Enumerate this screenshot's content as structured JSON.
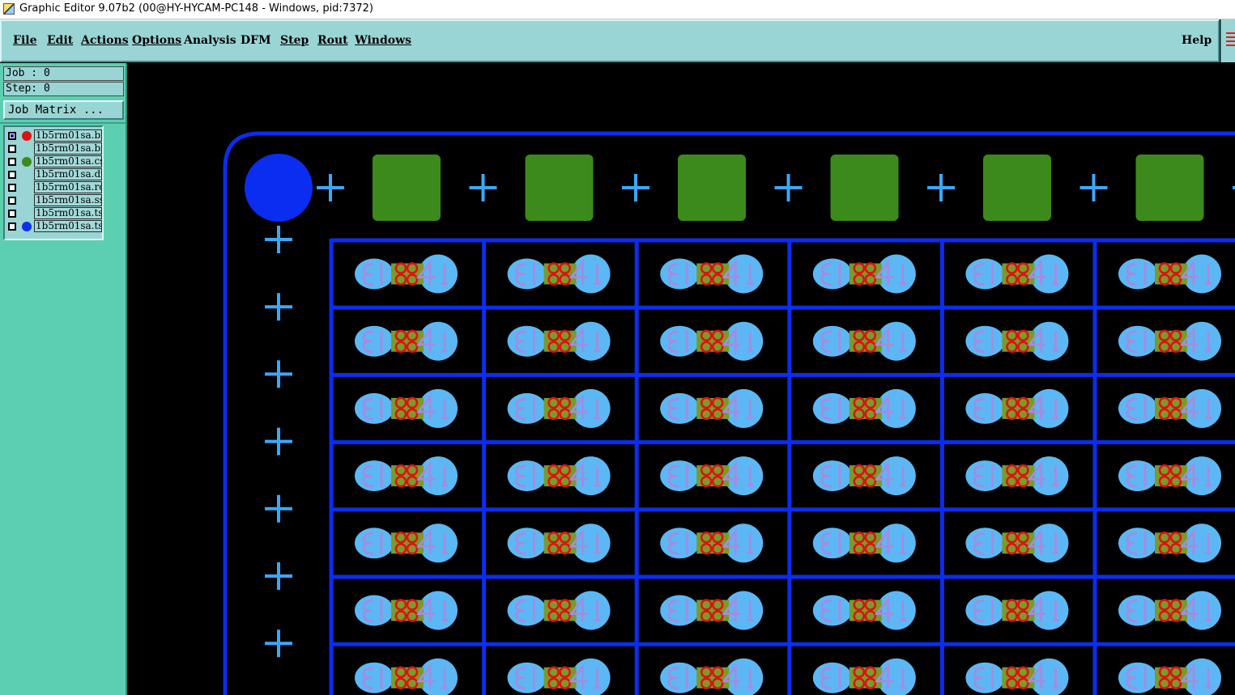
{
  "window": {
    "title": "Graphic Editor 9.07b2 (00@HY-HYCAM-PC148 - Windows, pid:7372)"
  },
  "menu": {
    "items": [
      {
        "id": "file",
        "label": "File",
        "underline": "F"
      },
      {
        "id": "edit",
        "label": "Edit",
        "underline": "E"
      },
      {
        "id": "actions",
        "label": "Actions",
        "underline": "A"
      },
      {
        "id": "options",
        "label": "Options",
        "underline": "O"
      },
      {
        "id": "analysis",
        "label": "Analysis",
        "underline": ""
      },
      {
        "id": "dfm",
        "label": "DFM",
        "underline": ""
      },
      {
        "id": "step",
        "label": "Step",
        "underline": "S"
      },
      {
        "id": "rout",
        "label": "Rout",
        "underline": "R"
      },
      {
        "id": "windows",
        "label": "Windows",
        "underline": "W"
      },
      {
        "id": "help",
        "label": "Help",
        "underline": ""
      }
    ]
  },
  "sidebar": {
    "job_line": "Job : 0",
    "step_line": "Step: 0",
    "job_matrix_button": "Job Matrix ...",
    "layers": [
      {
        "name": "1b5rm01sa.bm",
        "color": "#e01010",
        "checked": true
      },
      {
        "name": "1b5rm01sa.bs",
        "color": "",
        "checked": false
      },
      {
        "name": "1b5rm01sa.cs",
        "color": "#3d8a1c",
        "checked": false
      },
      {
        "name": "1b5rm01sa.dr",
        "color": "",
        "checked": false
      },
      {
        "name": "1b5rm01sa.ro",
        "color": "",
        "checked": false
      },
      {
        "name": "1b5rm01sa.ss",
        "color": "",
        "checked": false
      },
      {
        "name": "1b5rm01sa.ts",
        "color": "",
        "checked": false
      },
      {
        "name": "1b5rm01sa.ts",
        "color": "#1030f0",
        "checked": false
      }
    ]
  },
  "colors": {
    "outline_blue": "#0a2df0",
    "fiducial_blue": "#0a2df0",
    "cross_light_blue": "#3aa8ff",
    "pad_green": "#3d8a1c",
    "pad_light_blue": "#5bb8f5",
    "silk_lavender": "#a48ce0",
    "mask_red": "#e01010",
    "pad_olive": "#7a9a2a"
  },
  "board": {
    "unit_columns": 6,
    "unit_rows": 7,
    "top_pads": 6,
    "left_crosses": 7
  }
}
